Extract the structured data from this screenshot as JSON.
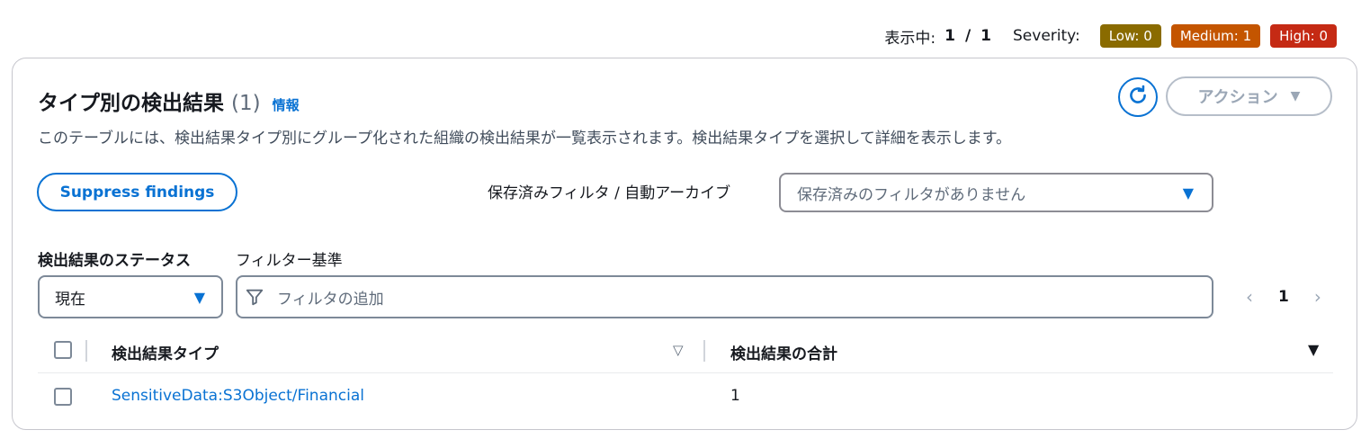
{
  "topbar": {
    "showing_label": "表示中:",
    "current": "1",
    "separator": "/",
    "total": "1",
    "severity_label": "Severity:",
    "badges": [
      {
        "label": "Low: 0",
        "color": "#8a6b00"
      },
      {
        "label": "Medium: 1",
        "color": "#c45500"
      },
      {
        "label": "High: 0",
        "color": "#c52a14"
      }
    ]
  },
  "panel": {
    "title": "タイプ別の検出結果",
    "count": "(1)",
    "info_link": "情報",
    "description": "このテーブルには、検出結果タイプ別にグループ化された組織の検出結果が一覧表示されます。検出結果タイプを選択して詳細を表示します。",
    "refresh_icon": "refresh-icon",
    "actions_label": "アクション",
    "suppress_label": "Suppress findings",
    "saved_filter_label": "保存済みフィルタ / 自動アーカイブ",
    "saved_filter_placeholder": "保存済みのフィルタがありません",
    "status_label": "検出結果のステータス",
    "status_value": "現在",
    "filter_label": "フィルター基準",
    "filter_placeholder": "フィルタの追加",
    "pagination": {
      "page": "1"
    }
  },
  "table": {
    "columns": [
      "検出結果タイプ",
      "検出結果の合計"
    ],
    "rows": [
      {
        "type": "SensitiveData:S3Object/Financial",
        "total": "1"
      }
    ]
  },
  "colors": {
    "accent": "#0972d3",
    "disabled": "#9ba7b6"
  }
}
